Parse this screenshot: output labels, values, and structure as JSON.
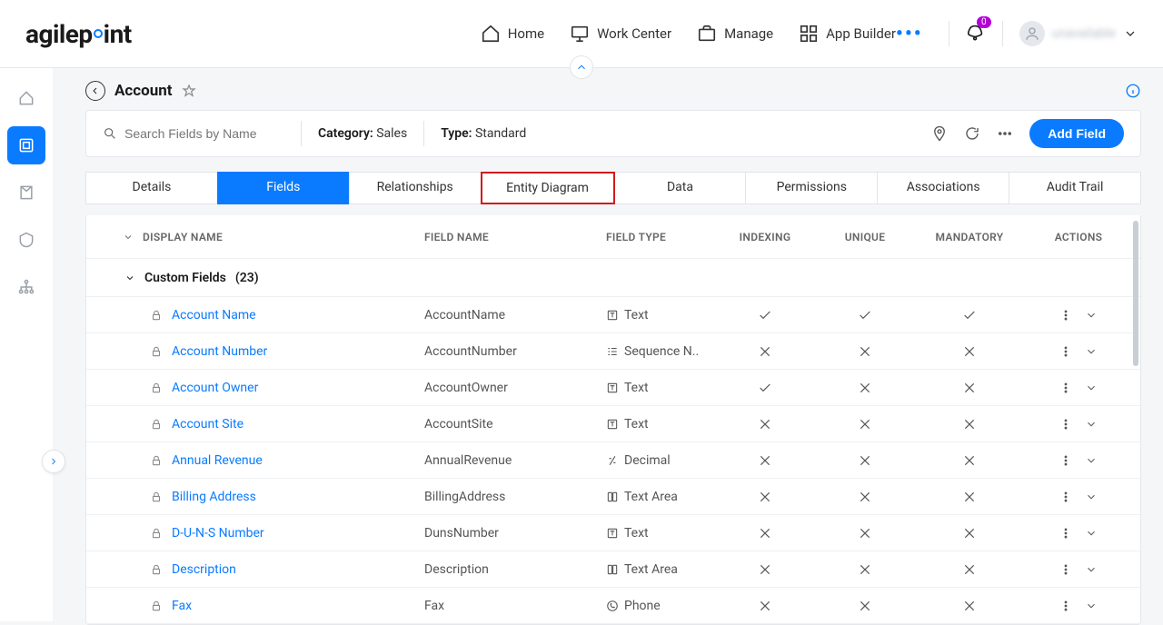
{
  "logoText": "agilepoint",
  "topnav": [
    {
      "label": "Home",
      "icon": "home"
    },
    {
      "label": "Work Center",
      "icon": "monitor"
    },
    {
      "label": "Manage",
      "icon": "briefcase"
    },
    {
      "label": "App Builder",
      "icon": "apps"
    }
  ],
  "notificationCount": "0",
  "userName": "unavailable",
  "pageTitle": "Account",
  "search": {
    "placeholder": "Search Fields by Name"
  },
  "filters": {
    "categoryLabel": "Category:",
    "categoryValue": "Sales",
    "typeLabel": "Type:",
    "typeValue": "Standard"
  },
  "addFieldLabel": "Add Field",
  "tabs": [
    "Details",
    "Fields",
    "Relationships",
    "Entity Diagram",
    "Data",
    "Permissions",
    "Associations",
    "Audit Trail"
  ],
  "activeTab": "Fields",
  "highlightedTab": "Entity Diagram",
  "columns": [
    "DISPLAY NAME",
    "FIELD NAME",
    "FIELD TYPE",
    "INDEXING",
    "UNIQUE",
    "MANDATORY",
    "ACTIONS"
  ],
  "group": {
    "label": "Custom Fields",
    "count": "(23)"
  },
  "rows": [
    {
      "display": "Account Name",
      "field": "AccountName",
      "type": "Text",
      "typeIcon": "text",
      "indexing": true,
      "unique": true,
      "mandatory": true
    },
    {
      "display": "Account Number",
      "field": "AccountNumber",
      "type": "Sequence N..",
      "typeIcon": "sequence",
      "indexing": false,
      "unique": false,
      "mandatory": false
    },
    {
      "display": "Account Owner",
      "field": "AccountOwner",
      "type": "Text",
      "typeIcon": "text",
      "indexing": true,
      "unique": false,
      "mandatory": false
    },
    {
      "display": "Account Site",
      "field": "AccountSite",
      "type": "Text",
      "typeIcon": "text",
      "indexing": false,
      "unique": false,
      "mandatory": false
    },
    {
      "display": "Annual Revenue",
      "field": "AnnualRevenue",
      "type": "Decimal",
      "typeIcon": "decimal",
      "indexing": false,
      "unique": false,
      "mandatory": false
    },
    {
      "display": "Billing Address",
      "field": "BillingAddress",
      "type": "Text Area",
      "typeIcon": "textarea",
      "indexing": false,
      "unique": false,
      "mandatory": false
    },
    {
      "display": "D-U-N-S Number",
      "field": "DunsNumber",
      "type": "Text",
      "typeIcon": "text",
      "indexing": false,
      "unique": false,
      "mandatory": false
    },
    {
      "display": "Description",
      "field": "Description",
      "type": "Text Area",
      "typeIcon": "textarea",
      "indexing": false,
      "unique": false,
      "mandatory": false
    },
    {
      "display": "Fax",
      "field": "Fax",
      "type": "Phone",
      "typeIcon": "phone",
      "indexing": false,
      "unique": false,
      "mandatory": false
    }
  ]
}
